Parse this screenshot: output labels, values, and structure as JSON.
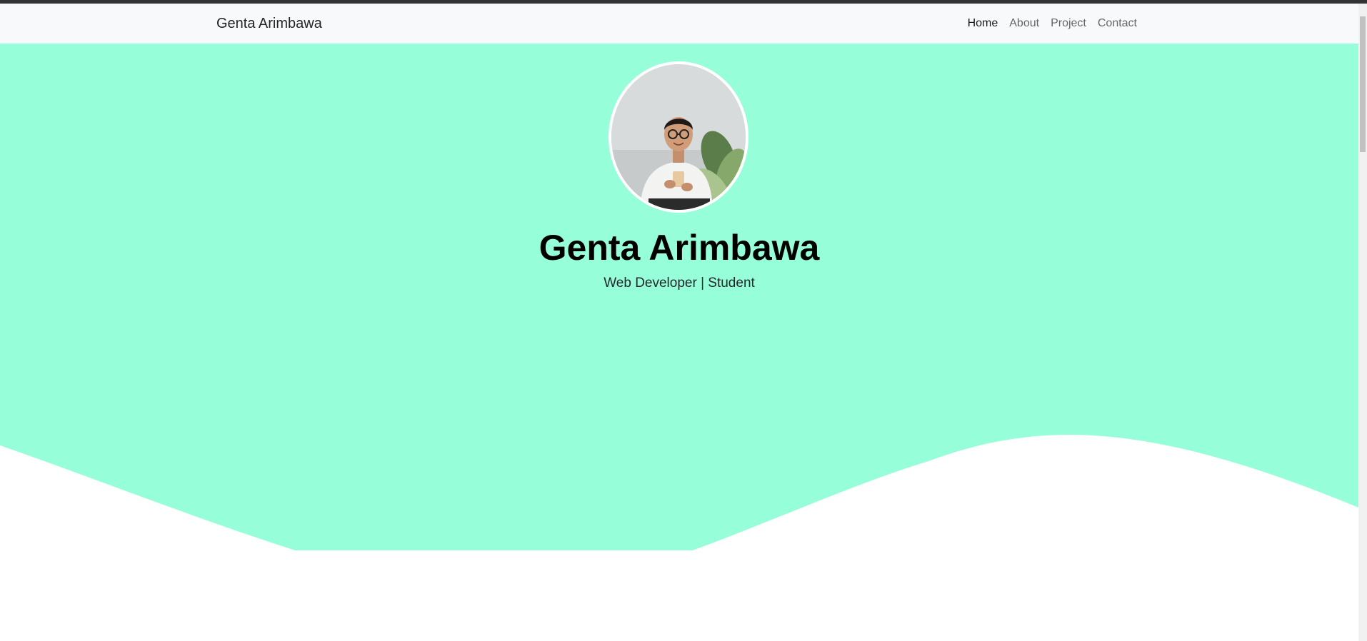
{
  "navbar": {
    "brand": "Genta Arimbawa",
    "links": [
      {
        "label": "Home",
        "active": true
      },
      {
        "label": "About",
        "active": false
      },
      {
        "label": "Project",
        "active": false
      },
      {
        "label": "Contact",
        "active": false
      }
    ]
  },
  "hero": {
    "name": "Genta Arimbawa",
    "tagline": "Web Developer | Student",
    "avatar_alt": "profile-photo",
    "background_color": "#96ffd9"
  },
  "colors": {
    "navbar_bg": "#f8f9fa",
    "accent": "#96ffd9",
    "page_bg": "#ffffff"
  }
}
